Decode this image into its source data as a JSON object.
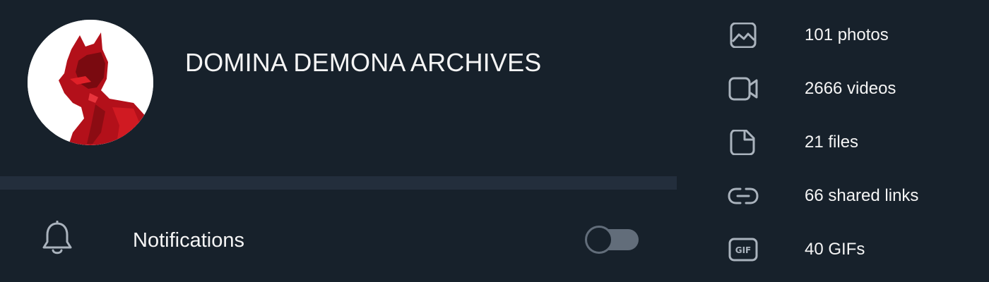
{
  "profile": {
    "title": "DOMINA DEMONA ARCHIVES"
  },
  "notifications": {
    "label": "Notifications",
    "enabled": false
  },
  "media": [
    {
      "icon": "photo-icon",
      "label": "101 photos"
    },
    {
      "icon": "video-icon",
      "label": "2666 videos"
    },
    {
      "icon": "file-icon",
      "label": "21 files"
    },
    {
      "icon": "link-icon",
      "label": "66 shared links"
    },
    {
      "icon": "gif-icon",
      "label": "40 GIFs",
      "badge": "GIF"
    }
  ],
  "colors": {
    "background": "#17212b",
    "divider": "#232e3c",
    "text": "#f5f5f5",
    "icon": "#aab3bd",
    "toggle_off": "#626d7a",
    "avatar_accent": "#c8141e"
  }
}
